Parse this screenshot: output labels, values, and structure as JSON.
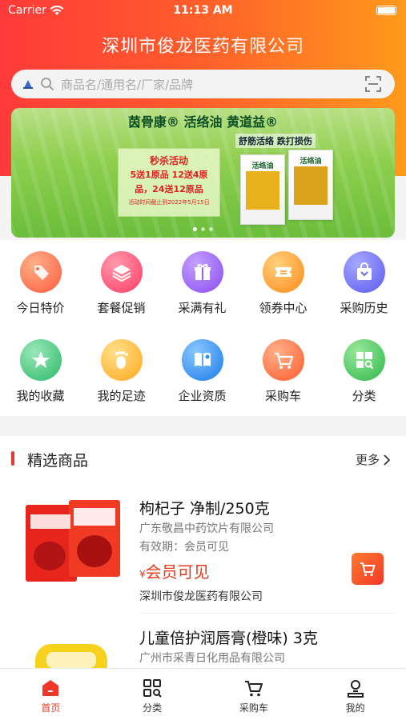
{
  "status": {
    "carrier": "Carrier",
    "time": "11:13 AM"
  },
  "header": {
    "title": "深圳市俊龙医药有限公司"
  },
  "search": {
    "placeholder": "商品名/通用名/厂家/品牌"
  },
  "banner": {
    "headline": "茵骨康® 活络油 黄道益®",
    "tagline": "舒筋活络 跌打损伤",
    "promo_title": "秒杀活动",
    "promo_line1": "5送1原品 12送4原",
    "promo_line2": "品，24送12原品",
    "promo_deadline": "活动时间截止到2022年5月15日",
    "box_name": "活络油"
  },
  "quick_menu": [
    {
      "label": "今日特价",
      "icon": "tag-icon",
      "color": "#ff5a3c"
    },
    {
      "label": "套餐促销",
      "icon": "layers-icon",
      "color": "#ff4a6a"
    },
    {
      "label": "采满有礼",
      "icon": "gift-icon",
      "color": "#9b5cf0"
    },
    {
      "label": "领券中心",
      "icon": "coupon-icon",
      "color": "#ff9a20"
    },
    {
      "label": "采购历史",
      "icon": "bag-icon",
      "color": "#6b6bf0"
    },
    {
      "label": "我的收藏",
      "icon": "star-icon",
      "color": "#3cc47a"
    },
    {
      "label": "我的足迹",
      "icon": "footprint-icon",
      "color": "#ffb020"
    },
    {
      "label": "企业资质",
      "icon": "certificate-icon",
      "color": "#2a8ef0"
    },
    {
      "label": "采购车",
      "icon": "cart-icon",
      "color": "#ff6a3c"
    },
    {
      "label": "分类",
      "icon": "category-icon",
      "color": "#3cc450"
    }
  ],
  "featured": {
    "title": "精选商品",
    "more": "更多",
    "products": [
      {
        "name": "枸杞子 净制/250克",
        "maker": "广东敬昌中药饮片有限公司",
        "expiry": "有效期：会员可见",
        "price_symbol": "¥",
        "price": "会员可见",
        "seller": "深圳市俊龙医药有限公司"
      },
      {
        "name": "儿童倍护润唇膏(橙味) 3克",
        "maker": "广州市采青日化用品有限公司"
      }
    ]
  },
  "tabbar": [
    {
      "label": "首页",
      "icon": "home-icon",
      "active": true
    },
    {
      "label": "分类",
      "icon": "category-icon",
      "active": false
    },
    {
      "label": "采购车",
      "icon": "cart-icon",
      "active": false
    },
    {
      "label": "我的",
      "icon": "user-icon",
      "active": false
    }
  ],
  "colors": {
    "accent": "#e8381f",
    "hero_start": "#ff3a3a",
    "hero_end": "#ff9a1c"
  }
}
